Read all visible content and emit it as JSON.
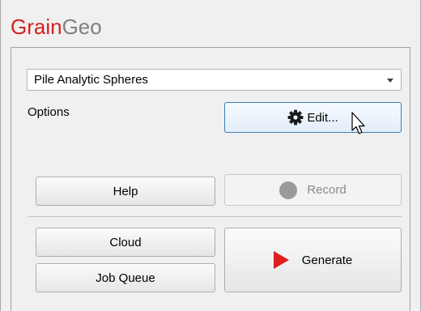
{
  "app": {
    "title_part1": "Grain",
    "title_part2": "Geo"
  },
  "preset_select": {
    "value": "Pile Analytic Spheres"
  },
  "options": {
    "label": "Options",
    "edit_label": "Edit..."
  },
  "buttons": {
    "help": "Help",
    "record": "Record",
    "cloud": "Cloud",
    "job_queue": "Job Queue",
    "generate": "Generate"
  },
  "colors": {
    "brand_red": "#d42020",
    "brand_gray": "#808080",
    "play_red": "#e01e1e"
  },
  "icons": {
    "edit": "gear-icon",
    "record": "record-circle-icon",
    "generate": "play-icon",
    "dropdown": "chevron-down-icon",
    "cursor": "mouse-pointer-icon"
  }
}
